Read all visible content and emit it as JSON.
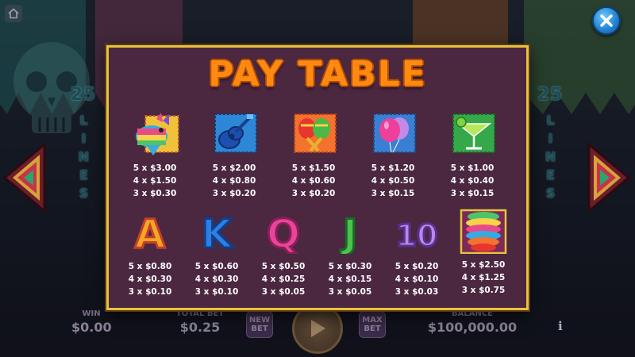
{
  "title": "PAY TABLE",
  "side_lines": {
    "count": "25",
    "word": "LINES"
  },
  "bottom_bar": {
    "win_label": "WIN",
    "win_value": "$0.00",
    "total_bet_label": "TOTAL BET",
    "total_bet_value": "$0.25",
    "new_bet_label": "NEW BET",
    "max_bet_label": "MAX BET",
    "balance_label": "BALANCE",
    "balance_value": "$100,000.00",
    "info_label": "i"
  },
  "symbols_row1": [
    {
      "name": "pinata",
      "icon": "donkey-pinata-icon",
      "pays": [
        "5 x $3.00",
        "4 x $1.50",
        "3 x $0.30"
      ]
    },
    {
      "name": "guitar",
      "icon": "guitar-icon",
      "pays": [
        "5 x $2.00",
        "4 x $0.80",
        "3 x $0.20"
      ]
    },
    {
      "name": "maracas",
      "icon": "maracas-icon",
      "pays": [
        "5 x $1.50",
        "4 x $0.60",
        "3 x $0.20"
      ]
    },
    {
      "name": "balloons",
      "icon": "balloons-icon",
      "pays": [
        "5 x $1.20",
        "4 x $0.50",
        "3 x $0.15"
      ]
    },
    {
      "name": "margarita",
      "icon": "margarita-icon",
      "pays": [
        "5 x $1.00",
        "4 x $0.40",
        "3 x $0.15"
      ]
    }
  ],
  "symbols_row2": [
    {
      "name": "A",
      "icon": "letter-a-icon",
      "glyph": "A",
      "pays": [
        "5 x $0.80",
        "4 x $0.30",
        "3 x $0.10"
      ]
    },
    {
      "name": "K",
      "icon": "letter-k-icon",
      "glyph": "K",
      "pays": [
        "5 x $0.60",
        "4 x $0.30",
        "3 x $0.10"
      ]
    },
    {
      "name": "Q",
      "icon": "letter-q-icon",
      "glyph": "Q",
      "pays": [
        "5 x $0.50",
        "4 x $0.25",
        "3 x $0.05"
      ]
    },
    {
      "name": "J",
      "icon": "letter-j-icon",
      "glyph": "J",
      "pays": [
        "5 x $0.30",
        "4 x $0.15",
        "3 x $0.05"
      ]
    },
    {
      "name": "10",
      "icon": "number-10-icon",
      "glyph": "10",
      "pays": [
        "5 x $0.20",
        "4 x $0.10",
        "3 x $0.03"
      ]
    },
    {
      "name": "scatter",
      "icon": "paper-decoration-icon",
      "pays": [
        "5 x $2.50",
        "4 x $1.25",
        "3 x $0.75"
      ]
    }
  ],
  "colors": {
    "panel_bg": "#4b2740",
    "panel_border": "#e8c33a",
    "title": "#ff8a12",
    "pay_text": "#ffffff"
  }
}
